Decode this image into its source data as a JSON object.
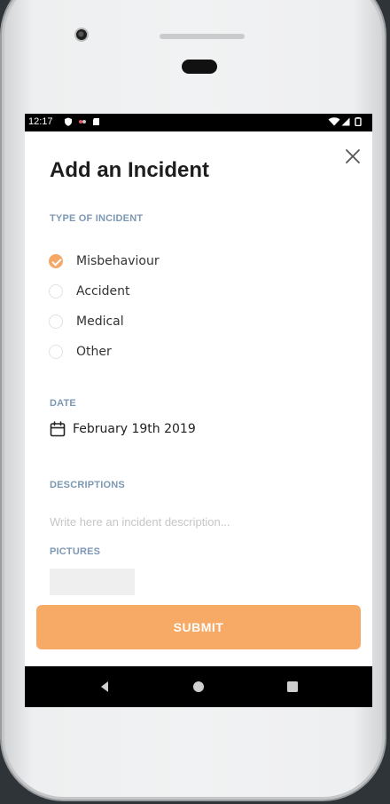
{
  "status_bar": {
    "time": "12:17"
  },
  "form": {
    "title": "Add an Incident",
    "type_label": "TYPE OF INCIDENT",
    "options": [
      {
        "label": "Misbehaviour",
        "checked": true
      },
      {
        "label": "Accident",
        "checked": false
      },
      {
        "label": "Medical",
        "checked": false
      },
      {
        "label": "Other",
        "checked": false
      }
    ],
    "date_label": "DATE",
    "date_value": "February 19th 2019",
    "descriptions_label": "DESCRIPTIONS",
    "description_placeholder": "Write here an incident description...",
    "description_value": "",
    "pictures_label": "PICTURES",
    "submit_label": "SUBMIT"
  },
  "icons": {
    "close": "close-icon",
    "calendar": "calendar-icon",
    "nav_back": "back-triangle-icon",
    "nav_home": "home-circle-icon",
    "nav_recents": "recents-square-icon"
  },
  "colors": {
    "accent": "#f7aa66",
    "section_label": "#7d98b3",
    "title": "#1e1e1e"
  }
}
